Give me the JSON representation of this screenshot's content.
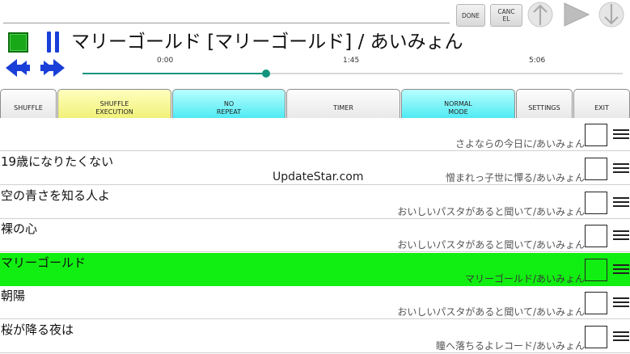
{
  "header": {
    "done_label": "DONE",
    "cancel_label": "CANC\nEL"
  },
  "now_playing": {
    "title": "マリーゴールド [マリーゴールド] / あいみょん",
    "time_start": "0:00",
    "time_mid": "1:45",
    "time_end": "5:06",
    "progress_fraction": 0.34
  },
  "controls": [
    {
      "label": "SHUFFLE",
      "style": "plain"
    },
    {
      "label": "SHUFFLE\nEXECUTION",
      "style": "yellow"
    },
    {
      "label": "NO\nREPEAT",
      "style": "cyan"
    },
    {
      "label": "TIMER",
      "style": "plain"
    },
    {
      "label": "NORMAL\nMODE",
      "style": "cyan"
    },
    {
      "label": "SETTINGS",
      "style": "plain"
    },
    {
      "label": "EXIT",
      "style": "plain"
    }
  ],
  "songs": [
    {
      "title": "",
      "subtitle": "さよならの今日に/あいみょん",
      "active": false
    },
    {
      "title": "19歳になりたくない",
      "subtitle": "憎まれっ子世に憚る/あいみょん",
      "active": false
    },
    {
      "title": "空の青さを知る人よ",
      "subtitle": "おいしいパスタがあると聞いて/あいみょん",
      "active": false
    },
    {
      "title": "裸の心",
      "subtitle": "おいしいパスタがあると聞いて/あいみょん",
      "active": false
    },
    {
      "title": "マリーゴールド",
      "subtitle": "マリーゴールド/あいみょん",
      "active": true
    },
    {
      "title": "朝陽",
      "subtitle": "おいしいパスタがあると聞いて/あいみょん",
      "active": false
    },
    {
      "title": "桜が降る夜は",
      "subtitle": "瞳へ落ちるよレコード/あいみょん",
      "active": false
    }
  ],
  "watermark": "UpdateStar.com",
  "colors": {
    "active_row": "#11ee11",
    "accent_blue": "#1a3fd8",
    "progress": "#12947e",
    "stop_green": "#18a818",
    "cyan_button": "#2fe4f0",
    "yellow_button": "#ecec62"
  },
  "icons": {
    "stop": "stop-icon",
    "pause": "pause-icon",
    "rewind": "rewind-icon",
    "fast_forward": "fast-forward-icon",
    "up": "arrow-up-icon",
    "play": "play-icon",
    "down": "arrow-down-icon",
    "drag": "drag-handle-icon"
  }
}
